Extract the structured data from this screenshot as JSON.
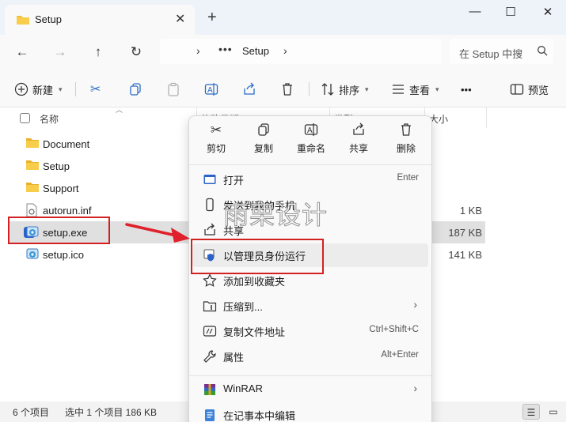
{
  "tab": {
    "title": "Setup",
    "close": "✕",
    "add": "+"
  },
  "window_controls": {
    "minimize": "—",
    "maximize": "☐",
    "close": "✕"
  },
  "nav": {
    "back": "←",
    "forward": "→",
    "up": "↑",
    "refresh": "↻",
    "breadcrumb_more": "•••",
    "breadcrumb_folder": "Setup",
    "search_text": "在 Setup 中搜",
    "chevron": "›"
  },
  "toolbar": {
    "new_label": "新建",
    "sort_label": "排序",
    "view_label": "查看",
    "more": "•••",
    "preview_label": "预览"
  },
  "columns": {
    "name": "名称",
    "modified": "修改日期",
    "type": "类型",
    "size": "大小"
  },
  "files": [
    {
      "name": "Document",
      "kind": "folder",
      "size": ""
    },
    {
      "name": "Setup",
      "kind": "folder",
      "size": ""
    },
    {
      "name": "Support",
      "kind": "folder",
      "size": ""
    },
    {
      "name": "autorun.inf",
      "kind": "inf",
      "size": "1 KB"
    },
    {
      "name": "setup.exe",
      "kind": "exe",
      "size": "187 KB",
      "selected": true
    },
    {
      "name": "setup.ico",
      "kind": "ico",
      "size": "141 KB"
    }
  ],
  "status": {
    "count": "6 个项目",
    "selection": "选中 1 个项目  186 KB"
  },
  "context_menu": {
    "quick_actions": [
      {
        "label": "剪切",
        "icon": "cut-icon"
      },
      {
        "label": "复制",
        "icon": "copy-icon"
      },
      {
        "label": "重命名",
        "icon": "rename-icon"
      },
      {
        "label": "共享",
        "icon": "share-icon"
      },
      {
        "label": "删除",
        "icon": "delete-icon"
      }
    ],
    "items": [
      {
        "label": "打开",
        "shortcut": "Enter",
        "icon": "open-icon"
      },
      {
        "label": "发送到我的手机",
        "shortcut": "",
        "icon": "phone-icon"
      },
      {
        "label": "共享",
        "shortcut": "",
        "icon": "share-icon"
      },
      {
        "label": "以管理员身份运行",
        "shortcut": "",
        "icon": "shield-icon"
      },
      {
        "label": "添加到收藏夹",
        "shortcut": "",
        "icon": "star-icon"
      },
      {
        "label": "压缩到...",
        "shortcut": "",
        "icon": "zip-icon",
        "submenu": true
      },
      {
        "label": "复制文件地址",
        "shortcut": "Ctrl+Shift+C",
        "icon": "path-icon"
      },
      {
        "label": "属性",
        "shortcut": "Alt+Enter",
        "icon": "wrench-icon"
      },
      {
        "label": "WinRAR",
        "shortcut": "",
        "icon": "winrar-icon",
        "submenu": true
      },
      {
        "label": "在记事本中编辑",
        "shortcut": "",
        "icon": "notepad-icon"
      }
    ],
    "submenu_arrow": "›"
  },
  "watermark": "雨栗设计",
  "colors": {
    "accent": "#2a62c9",
    "annotation_red": "#d32020",
    "folder": "#f2c13a"
  }
}
